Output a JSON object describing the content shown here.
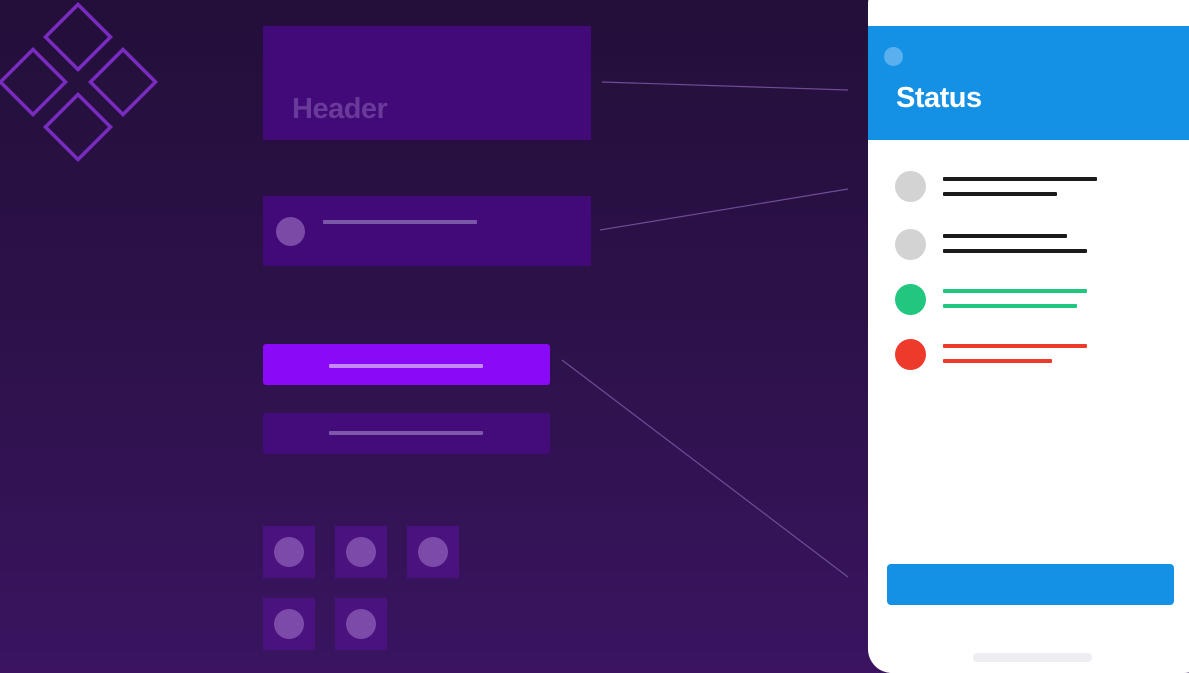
{
  "colors": {
    "background_top": "#230f3a",
    "background_bottom": "#3a1460",
    "wireframe_block": "#420a78",
    "primary_button": "#8a0af7",
    "accent_blue": "#1490e5",
    "neutral_dot": "#d3d3d3",
    "success": "#22c77f",
    "error": "#ee3a2b"
  },
  "logo": {
    "icon": "four-diamonds-logo"
  },
  "wireframe": {
    "header_label": "Header"
  },
  "phone": {
    "status_title": "Status",
    "status_rows": [
      {
        "state": "neutral",
        "color": "#d3d3d3",
        "line_color": "#1a1a1a"
      },
      {
        "state": "neutral",
        "color": "#d3d3d3",
        "line_color": "#1a1a1a"
      },
      {
        "state": "success",
        "color": "#22c77f",
        "line_color": "#22c77f"
      },
      {
        "state": "error",
        "color": "#ee3a2b",
        "line_color": "#ee3a2b"
      }
    ]
  }
}
